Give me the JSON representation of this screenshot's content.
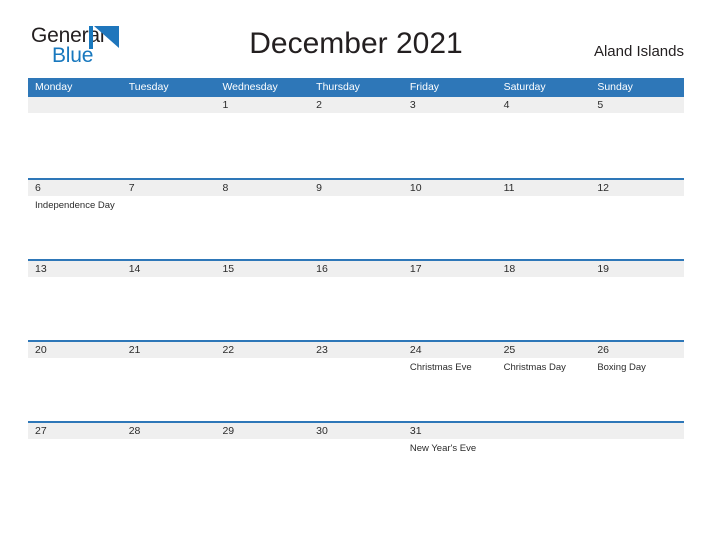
{
  "brand": {
    "name_top": "General",
    "name_bottom": "Blue",
    "accent_color": "#1878be"
  },
  "header": {
    "title": "December 2021",
    "country": "Aland Islands"
  },
  "calendar": {
    "header_color": "#2e77b8",
    "band_color": "#efefef",
    "weekdays": [
      "Monday",
      "Tuesday",
      "Wednesday",
      "Thursday",
      "Friday",
      "Saturday",
      "Sunday"
    ],
    "weeks": [
      [
        {
          "day": ""
        },
        {
          "day": ""
        },
        {
          "day": "1"
        },
        {
          "day": "2"
        },
        {
          "day": "3"
        },
        {
          "day": "4"
        },
        {
          "day": "5"
        }
      ],
      [
        {
          "day": "6",
          "events": [
            "Independence Day"
          ]
        },
        {
          "day": "7"
        },
        {
          "day": "8"
        },
        {
          "day": "9"
        },
        {
          "day": "10"
        },
        {
          "day": "11"
        },
        {
          "day": "12"
        }
      ],
      [
        {
          "day": "13"
        },
        {
          "day": "14"
        },
        {
          "day": "15"
        },
        {
          "day": "16"
        },
        {
          "day": "17"
        },
        {
          "day": "18"
        },
        {
          "day": "19"
        }
      ],
      [
        {
          "day": "20"
        },
        {
          "day": "21"
        },
        {
          "day": "22"
        },
        {
          "day": "23"
        },
        {
          "day": "24",
          "events": [
            "Christmas Eve"
          ]
        },
        {
          "day": "25",
          "events": [
            "Christmas Day"
          ]
        },
        {
          "day": "26",
          "events": [
            "Boxing Day"
          ]
        }
      ],
      [
        {
          "day": "27"
        },
        {
          "day": "28"
        },
        {
          "day": "29"
        },
        {
          "day": "30"
        },
        {
          "day": "31",
          "events": [
            "New Year's Eve"
          ]
        },
        {
          "day": ""
        },
        {
          "day": ""
        }
      ]
    ]
  }
}
